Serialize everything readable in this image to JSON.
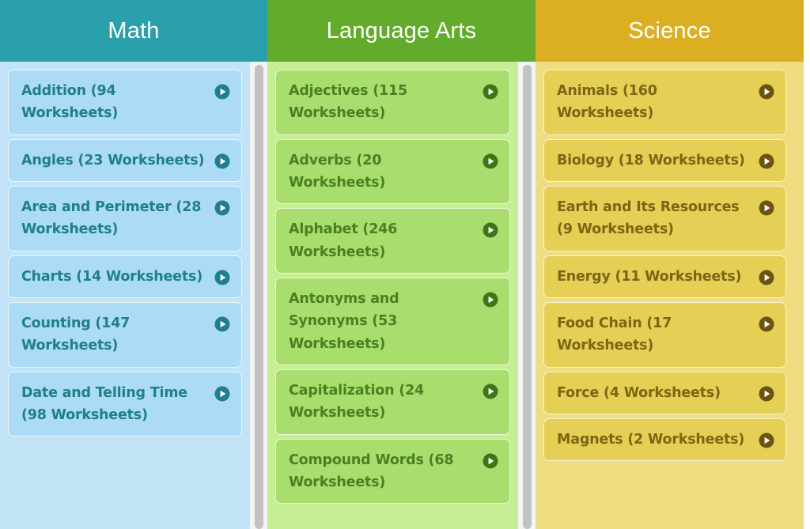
{
  "columns": [
    {
      "key": "math",
      "title": "Math",
      "header_color": "#2AA0AC",
      "panel_color": "#C2E3F6",
      "card_color": "#ACDCF5",
      "text_color": "#1F7F8C",
      "has_scrollbar": true,
      "items": [
        {
          "label": "Addition (94 Worksheets)",
          "icon": "play-icon"
        },
        {
          "label": "Angles (23 Worksheets)",
          "icon": "play-icon"
        },
        {
          "label": "Area and Perimeter (28 Worksheets)",
          "icon": "play-icon"
        },
        {
          "label": "Charts (14 Worksheets)",
          "icon": "play-icon"
        },
        {
          "label": "Counting (147 Worksheets)",
          "icon": "play-icon"
        },
        {
          "label": "Date and Telling Time (98 Worksheets)",
          "icon": "play-icon"
        }
      ]
    },
    {
      "key": "language",
      "title": "Language Arts",
      "header_color": "#63AC2B",
      "panel_color": "#C6EE94",
      "card_color": "#A9DE6E",
      "text_color": "#4A8021",
      "has_scrollbar": true,
      "items": [
        {
          "label": "Adjectives (115 Worksheets)",
          "icon": "play-icon"
        },
        {
          "label": "Adverbs (20 Worksheets)",
          "icon": "play-icon"
        },
        {
          "label": "Alphabet (246 Worksheets)",
          "icon": "play-icon"
        },
        {
          "label": "Antonyms and Synonyms (53 Worksheets)",
          "icon": "play-icon"
        },
        {
          "label": "Capitalization (24 Worksheets)",
          "icon": "play-icon"
        },
        {
          "label": "Compound Words (68 Worksheets)",
          "icon": "play-icon"
        }
      ]
    },
    {
      "key": "science",
      "title": "Science",
      "header_color": "#DCAF22",
      "panel_color": "#EFDD81",
      "card_color": "#E5D055",
      "text_color": "#7D6515",
      "has_scrollbar": false,
      "items": [
        {
          "label": "Animals (160 Worksheets)",
          "icon": "play-icon"
        },
        {
          "label": "Biology (18 Worksheets)",
          "icon": "play-icon"
        },
        {
          "label": "Earth and Its Resources (9 Worksheets)",
          "icon": "play-icon"
        },
        {
          "label": "Energy (11 Worksheets)",
          "icon": "play-icon"
        },
        {
          "label": "Food Chain (17 Worksheets)",
          "icon": "play-icon"
        },
        {
          "label": "Force (4 Worksheets)",
          "icon": "play-icon"
        },
        {
          "label": "Magnets (2 Worksheets)",
          "icon": "play-icon"
        }
      ]
    }
  ]
}
